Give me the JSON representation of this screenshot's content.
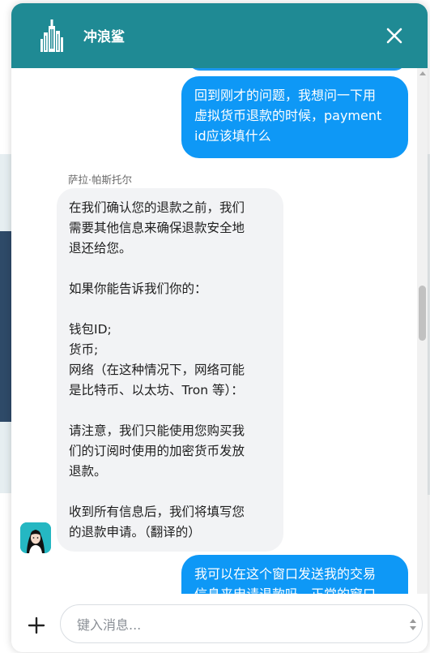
{
  "header": {
    "title": "冲浪鲨",
    "logo_icon": "city-skyline-icon",
    "close_icon": "close-icon",
    "background_color": "#1f8a94"
  },
  "messages": {
    "outgoing_1": {
      "lines": [
        "回到刚才的问题，我想问一下用",
        "虚拟货币退款的时候，payment",
        "id应该填什么"
      ]
    },
    "incoming": {
      "sender": "萨拉·帕斯托尔",
      "lines": [
        "在我们确认您的退款之前，我们",
        "需要其他信息来确保退款安全地",
        "退还给您。",
        "",
        "如果你能告诉我们你的：",
        "",
        "钱包ID;",
        "货币;",
        "网络（在这种情况下，网络可能",
        "是比特币、以太坊、Tron 等）：",
        "",
        "请注意，我们只能使用您购买我",
        "们的订阅时使用的加密货币发放",
        "退款。",
        "",
        "收到所有信息后，我们将填写您",
        "的退款申请。（翻译的）"
      ]
    },
    "outgoing_2": {
      "lines": [
        "我可以在这个窗口发送我的交易",
        "信息来申请退款吗，正常的窗口"
      ]
    },
    "outgoing_color": "#0e98f6",
    "incoming_color": "#f2f3f5"
  },
  "composer": {
    "placeholder": "键入消息...",
    "value": "",
    "attach_icon": "plus-icon"
  }
}
